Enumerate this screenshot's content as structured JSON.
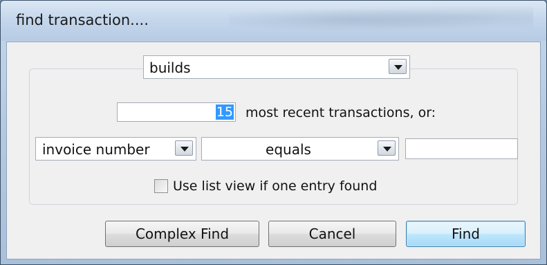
{
  "window": {
    "title": "find transaction...."
  },
  "type_combo": {
    "value": "builds"
  },
  "recent": {
    "count": "15",
    "label": "most recent transactions, or:"
  },
  "criteria": {
    "field": "invoice number",
    "operator": "equals",
    "value": ""
  },
  "list_view": {
    "label": "Use list view if one entry found",
    "checked": false
  },
  "buttons": {
    "complex_find": "Complex Find",
    "cancel": "Cancel",
    "find": "Find"
  }
}
